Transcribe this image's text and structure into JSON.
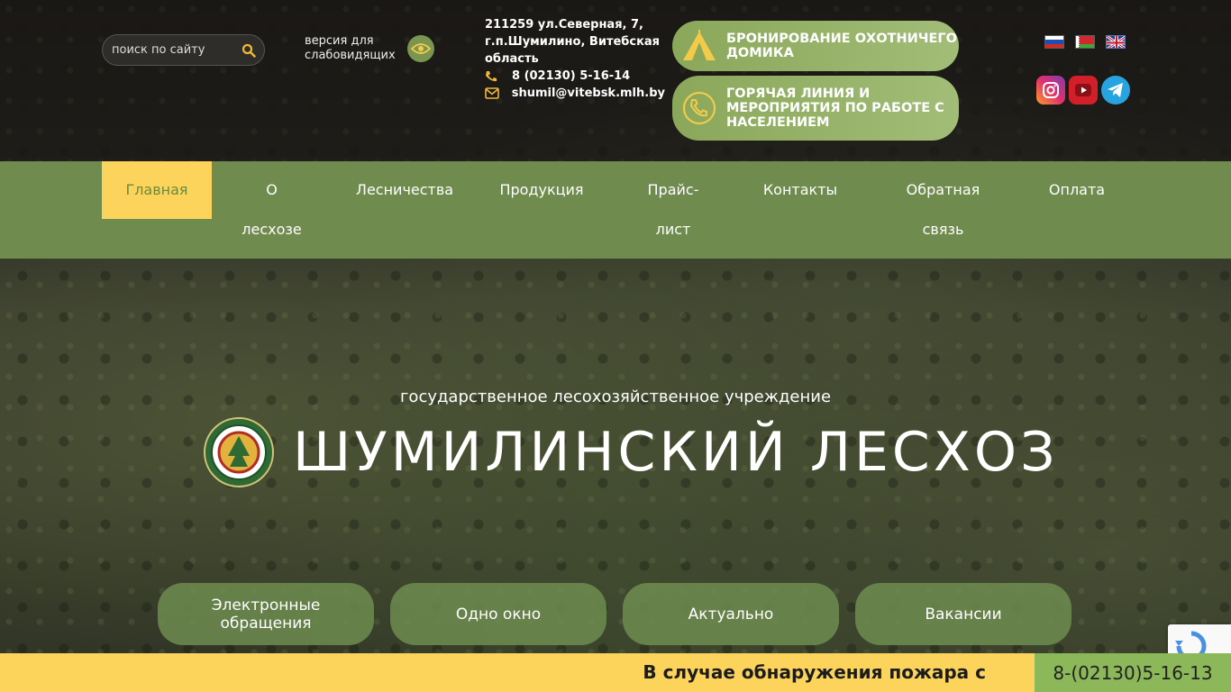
{
  "header": {
    "search_placeholder": "поиск по сайту",
    "vision_label": "версия для слабовидящих",
    "address": "211259 ул.Северная, 7, г.п.Шумилино, Витебская область",
    "phone": "8 (02130) 5-16-14",
    "email": "shumil@vitebsk.mlh.by",
    "booking_button": "БРОНИРОВАНИЕ ОХОТНИЧЕГО ДОМИКА",
    "hotline_button": "ГОРЯЧАЯ ЛИНИЯ И МЕРОПРИЯТИЯ ПО РАБОТЕ С НАСЕЛЕНИЕМ",
    "languages": [
      "ru-flag-icon",
      "by-flag-icon",
      "gb-flag-icon"
    ],
    "socials": [
      "instagram-icon",
      "youtube-icon",
      "telegram-icon"
    ]
  },
  "nav": {
    "items": [
      "Главная",
      "О лесхозе",
      "Лесничества",
      "Продукция",
      "Прайс-лист",
      "Контакты",
      "Обратная связь",
      "Оплата"
    ],
    "active": "Главная"
  },
  "hero": {
    "subtitle": "государственное лесохозяйственное учреждение",
    "title": "ШУМИЛИНСКИЙ ЛЕСХОЗ"
  },
  "quick_links": [
    "Электронные обращения",
    "Одно окно",
    "Актуально",
    "Вакансии"
  ],
  "footer": {
    "fire_notice": "В случае обнаружения пожара с",
    "fire_phone": "8-(02130)5-16-13"
  },
  "colors": {
    "nav_bg": "#6f8c4e",
    "accent_yellow": "#fcd45c",
    "pill_green": "#8aa75a"
  }
}
